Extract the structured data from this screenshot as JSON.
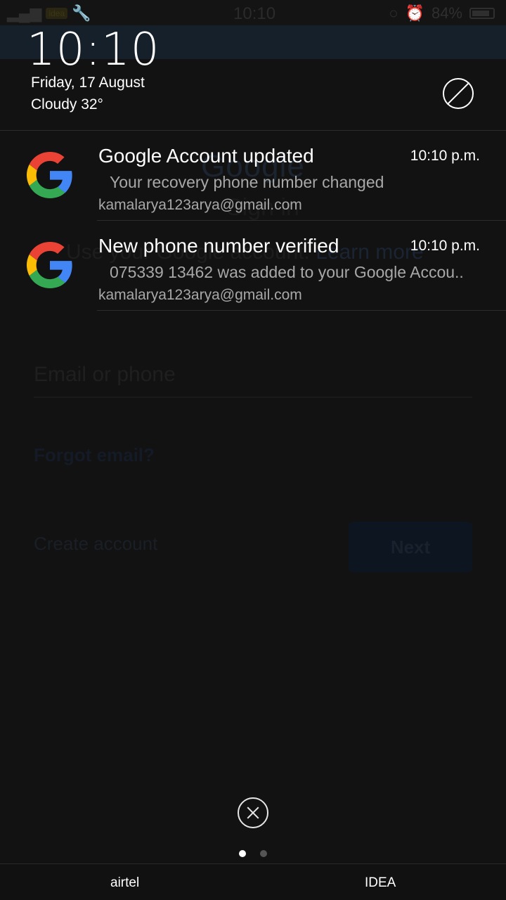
{
  "status_bar": {
    "time": "10:10",
    "carrier_badge": "idea",
    "battery": "84%",
    "battery_level": 0.84
  },
  "background_app": {
    "logo": "Google",
    "title": "Sign in",
    "subtitle_start": "Use your Google account.",
    "subtitle_link": "Learn more",
    "email_placeholder": "Email or phone",
    "forgot_link": "Forgot email?",
    "create_account": "Create account",
    "next_button": "Next"
  },
  "lock": {
    "clock": "10:10",
    "date": "Friday, 17 August",
    "weather": "Cloudy 32°"
  },
  "notifications": [
    {
      "icon": "google-g-icon",
      "title": "Google Account updated",
      "time": "10:10 p.m.",
      "text": "Your recovery phone number changed",
      "account": "kamalarya123arya@gmail.com"
    },
    {
      "icon": "google-g-icon",
      "title": "New phone number verified",
      "time": "10:10 p.m.",
      "text": "075339 13462 was added to your Google Accou..",
      "account": "kamalarya123arya@gmail.com"
    }
  ],
  "carriers": [
    "airtel",
    "IDEA"
  ],
  "colors": {
    "google_red": "#EA4335",
    "google_blue": "#4285F4",
    "google_yellow": "#FBBC05",
    "google_green": "#34A853"
  }
}
